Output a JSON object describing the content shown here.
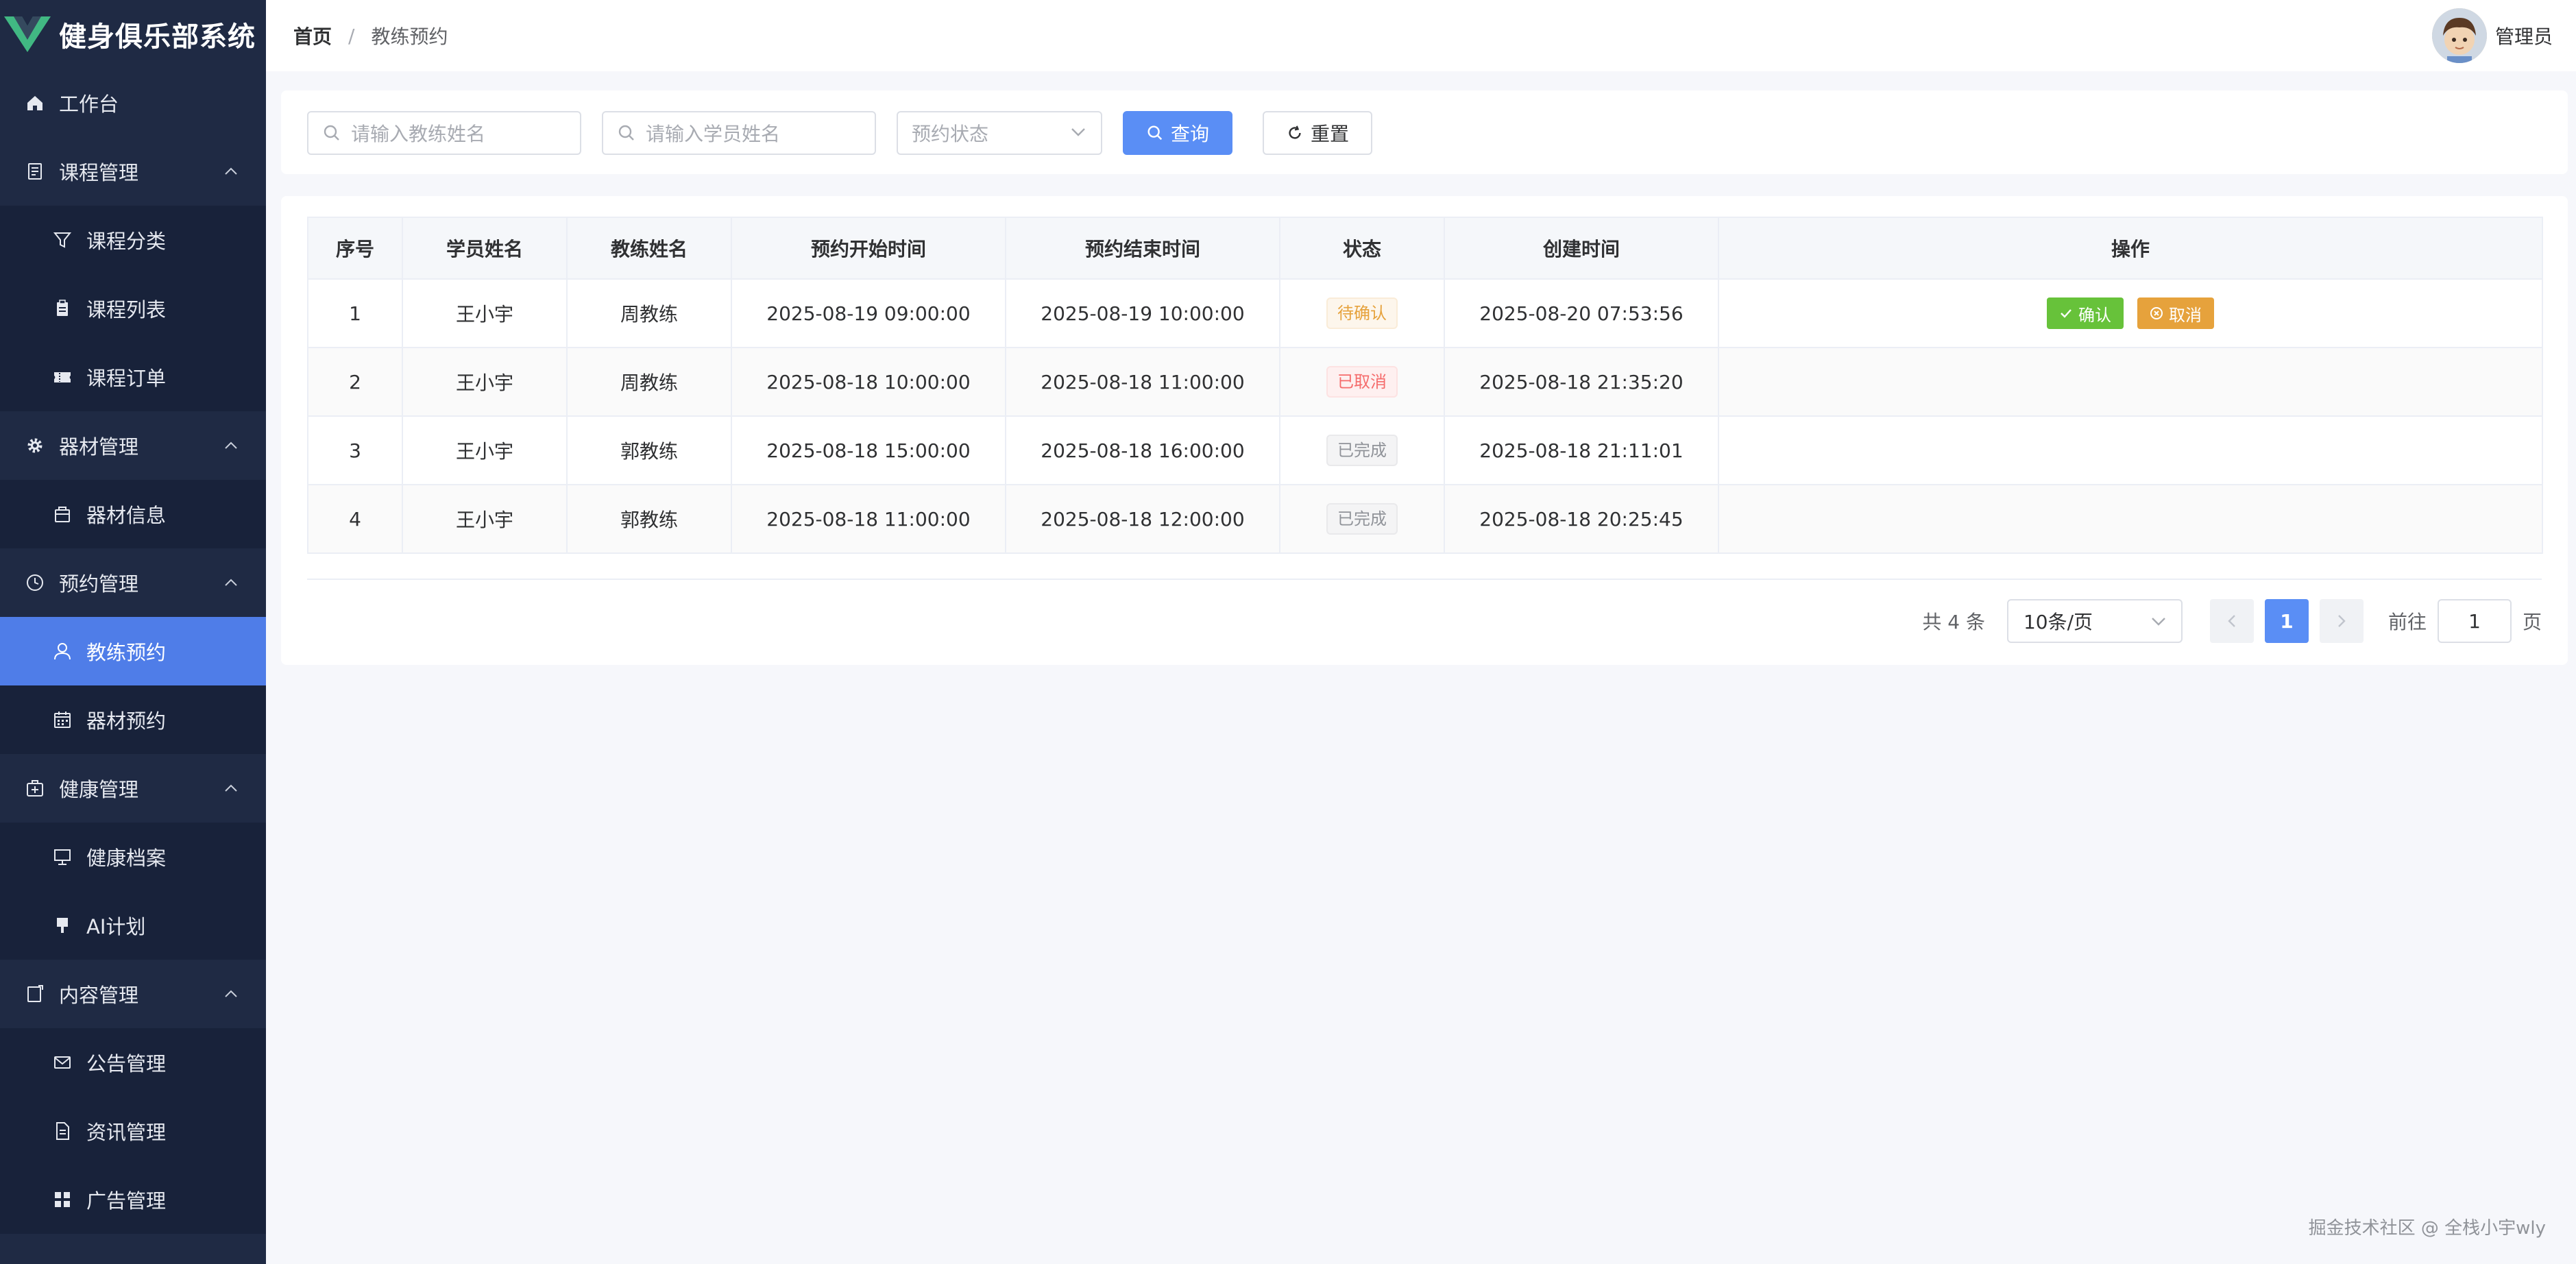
{
  "app": {
    "title": "健身俱乐部系统"
  },
  "colors": {
    "sidebar_bg": "#1f2a44",
    "active": "#4f7de8",
    "primary": "#5a8ef5",
    "success": "#67c23a",
    "warning": "#e6a23c",
    "danger": "#f56c6c"
  },
  "sidebar": {
    "items": [
      {
        "label": "工作台",
        "icon": "home-icon",
        "level": "top"
      },
      {
        "label": "课程管理",
        "icon": "document-icon",
        "level": "top",
        "expanded": true
      },
      {
        "label": "课程分类",
        "icon": "filter-icon",
        "level": "sub"
      },
      {
        "label": "课程列表",
        "icon": "clipboard-icon",
        "level": "sub"
      },
      {
        "label": "课程订单",
        "icon": "ticket-icon",
        "level": "sub"
      },
      {
        "label": "器材管理",
        "icon": "gear-icon",
        "level": "top",
        "expanded": true
      },
      {
        "label": "器材信息",
        "icon": "box-icon",
        "level": "sub"
      },
      {
        "label": "预约管理",
        "icon": "clock-icon",
        "level": "top",
        "expanded": true
      },
      {
        "label": "教练预约",
        "icon": "user-icon",
        "level": "sub",
        "active": true
      },
      {
        "label": "器材预约",
        "icon": "calendar-icon",
        "level": "sub"
      },
      {
        "label": "健康管理",
        "icon": "first-aid-icon",
        "level": "top",
        "expanded": true
      },
      {
        "label": "健康档案",
        "icon": "monitor-icon",
        "level": "sub"
      },
      {
        "label": "AI计划",
        "icon": "brush-icon",
        "level": "sub"
      },
      {
        "label": "内容管理",
        "icon": "notebook-icon",
        "level": "top",
        "expanded": true
      },
      {
        "label": "公告管理",
        "icon": "mail-icon",
        "level": "sub"
      },
      {
        "label": "资讯管理",
        "icon": "file-icon",
        "level": "sub"
      },
      {
        "label": "广告管理",
        "icon": "grid-icon",
        "level": "sub"
      }
    ]
  },
  "header": {
    "breadcrumb": {
      "home": "首页",
      "separator": "/",
      "current": "教练预约"
    },
    "user": {
      "name": "管理员"
    }
  },
  "filters": {
    "coach_placeholder": "请输入教练姓名",
    "student_placeholder": "请输入学员姓名",
    "status_placeholder": "预约状态",
    "search_label": "查询",
    "reset_label": "重置"
  },
  "table": {
    "columns": [
      "序号",
      "学员姓名",
      "教练姓名",
      "预约开始时间",
      "预约结束时间",
      "状态",
      "创建时间",
      "操作"
    ],
    "rows": [
      {
        "index": "1",
        "student": "王小宇",
        "coach": "周教练",
        "start": "2025-08-19 09:00:00",
        "end": "2025-08-19 10:00:00",
        "status": "待确认",
        "status_type": "pending",
        "created": "2025-08-20 07:53:56",
        "actions": [
          "确认",
          "取消"
        ]
      },
      {
        "index": "2",
        "student": "王小宇",
        "coach": "周教练",
        "start": "2025-08-18 10:00:00",
        "end": "2025-08-18 11:00:00",
        "status": "已取消",
        "status_type": "cancel",
        "created": "2025-08-18 21:35:20",
        "actions": []
      },
      {
        "index": "3",
        "student": "王小宇",
        "coach": "郭教练",
        "start": "2025-08-18 15:00:00",
        "end": "2025-08-18 16:00:00",
        "status": "已完成",
        "status_type": "done",
        "created": "2025-08-18 21:11:01",
        "actions": []
      },
      {
        "index": "4",
        "student": "王小宇",
        "coach": "郭教练",
        "start": "2025-08-18 11:00:00",
        "end": "2025-08-18 12:00:00",
        "status": "已完成",
        "status_type": "done",
        "created": "2025-08-18 20:25:45",
        "actions": []
      }
    ]
  },
  "pagination": {
    "total_label": "共 4 条",
    "page_size": "10条/页",
    "current_page": "1",
    "goto_prefix": "前往",
    "goto_value": "1",
    "goto_suffix": "页"
  },
  "footer": {
    "note": "掘金技术社区 @ 全栈小宇wly"
  }
}
